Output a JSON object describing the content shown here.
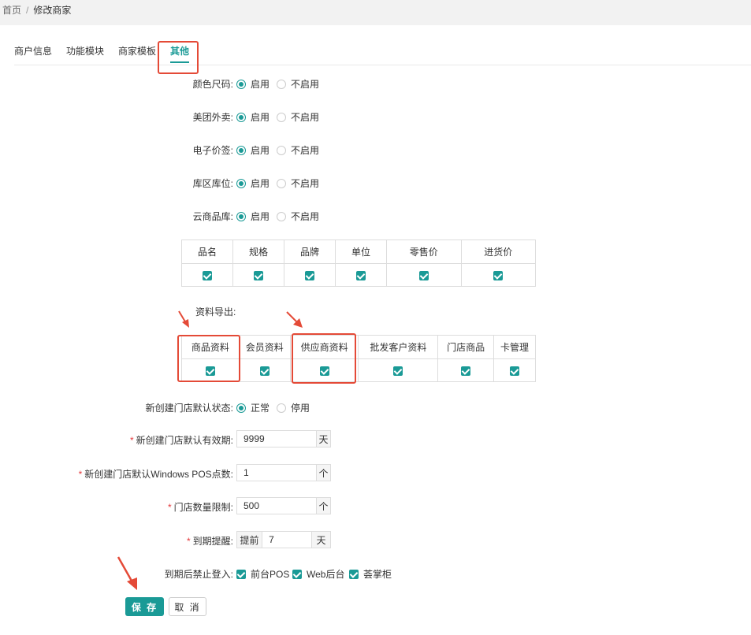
{
  "breadcrumb": {
    "home": "首页",
    "separator": "/",
    "current": "修改商家"
  },
  "tabs": [
    {
      "label": "商户信息",
      "active": false
    },
    {
      "label": "功能模块",
      "active": false
    },
    {
      "label": "商家模板",
      "active": false
    },
    {
      "label": "其他",
      "active": true
    }
  ],
  "toggles": [
    {
      "label": "颜色尺码:",
      "on": "启用",
      "off": "不启用",
      "value": "启用"
    },
    {
      "label": "美团外卖:",
      "on": "启用",
      "off": "不启用",
      "value": "启用"
    },
    {
      "label": "电子价签:",
      "on": "启用",
      "off": "不启用",
      "value": "启用"
    },
    {
      "label": "库区库位:",
      "on": "启用",
      "off": "不启用",
      "value": "启用"
    },
    {
      "label": "云商品库:",
      "on": "启用",
      "off": "不启用",
      "value": "启用"
    }
  ],
  "fields_table": {
    "headers": [
      "品名",
      "规格",
      "品牌",
      "单位",
      "零售价",
      "进货价"
    ],
    "checked": [
      true,
      true,
      true,
      true,
      true,
      true
    ]
  },
  "export": {
    "label": "资料导出:",
    "headers": [
      "商品资料",
      "会员资料",
      "供应商资料",
      "批发客户资料",
      "门店商品",
      "卡管理"
    ],
    "checked": [
      true,
      true,
      true,
      true,
      true,
      true
    ]
  },
  "store_status": {
    "label": "新创建门店默认状态:",
    "options": [
      "正常",
      "停用"
    ],
    "value": "正常"
  },
  "validity": {
    "label": "新创建门店默认有效期:",
    "value": "9999",
    "unit": "天"
  },
  "pos_count": {
    "label": "新创建门店默认Windows POS点数:",
    "value": "1",
    "unit": "个"
  },
  "store_limit": {
    "label": "门店数量限制:",
    "value": "500",
    "unit": "个"
  },
  "expiry_reminder": {
    "label": "到期提醒:",
    "prefix": "提前",
    "value": "7",
    "unit": "天"
  },
  "login_ban": {
    "label": "到期后禁止登入:",
    "options": [
      "前台POS",
      "Web后台",
      "荟掌柜"
    ],
    "checked": [
      true,
      true,
      true
    ]
  },
  "buttons": {
    "save": "保 存",
    "cancel": "取 消"
  },
  "required_mark": "*",
  "colors": {
    "accent": "#1a9a96",
    "highlight": "#e44a37"
  }
}
